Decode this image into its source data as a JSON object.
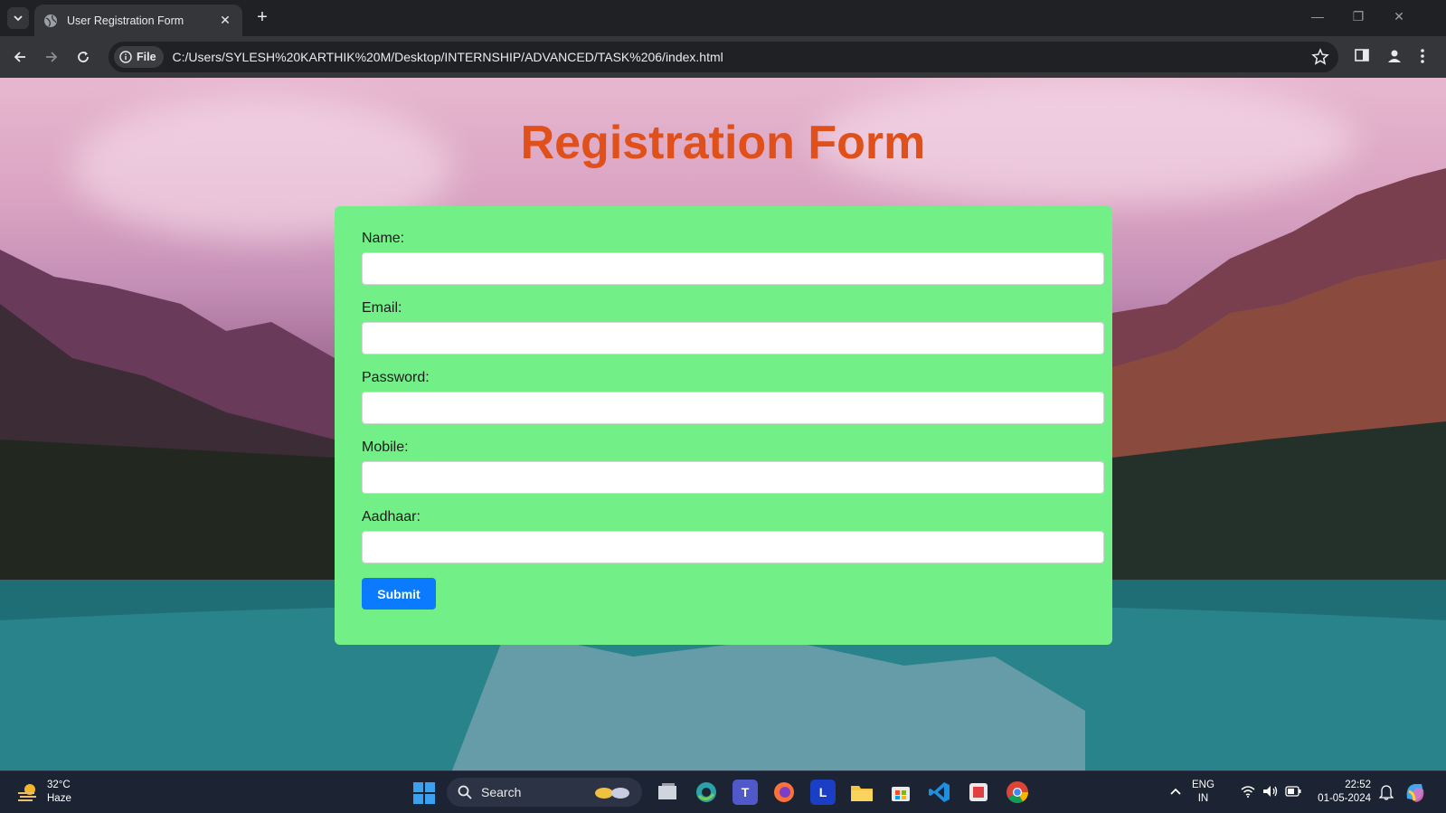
{
  "browser": {
    "tab_title": "User Registration Form",
    "url_scheme_chip": "File",
    "url": "C:/Users/SYLESH%20KARTHIK%20M/Desktop/INTERNSHIP/ADVANCED/TASK%206/index.html"
  },
  "page": {
    "title": "Registration Form",
    "fields": [
      {
        "label": "Name:",
        "value": ""
      },
      {
        "label": "Email:",
        "value": ""
      },
      {
        "label": "Password:",
        "value": ""
      },
      {
        "label": "Mobile:",
        "value": ""
      },
      {
        "label": "Aadhaar:",
        "value": ""
      }
    ],
    "submit_label": "Submit",
    "colors": {
      "title": "#e0501a",
      "card": "#72f087",
      "button": "#0a7bff"
    }
  },
  "taskbar": {
    "weather_temp": "32°C",
    "weather_desc": "Haze",
    "search_label": "Search",
    "apps": [
      "start-icon",
      "task-view-icon",
      "edge-icon",
      "teams-icon",
      "firefox-icon",
      "l-app-icon",
      "file-explorer-icon",
      "store-icon",
      "vscode-icon",
      "snipping-tool-icon",
      "chrome-icon"
    ],
    "lang_primary": "ENG",
    "lang_secondary": "IN",
    "time": "22:52",
    "date": "01-05-2024"
  }
}
